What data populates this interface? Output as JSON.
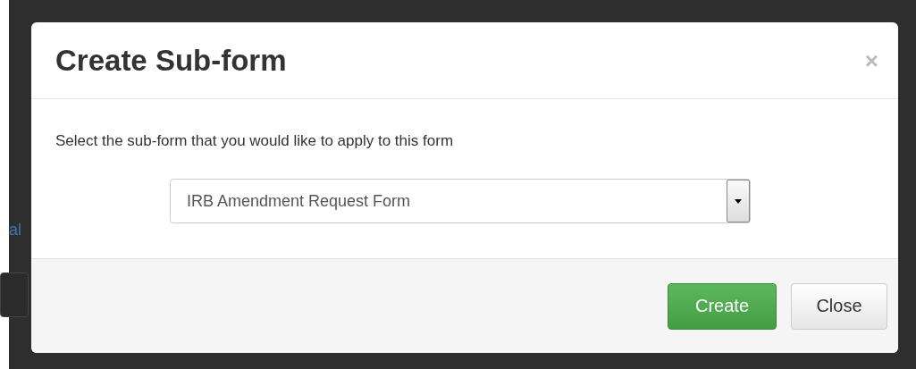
{
  "background_page": {
    "link": "al"
  },
  "dialog": {
    "title": "Create Sub-form",
    "close_icon": "×",
    "message": "Select the sub-form that you would like to apply to this form",
    "select": {
      "value": "IRB Amendment Request Form"
    },
    "buttons": [
      {
        "label": "Create",
        "kind": "primary"
      },
      {
        "label": "Close",
        "kind": "default"
      }
    ]
  }
}
